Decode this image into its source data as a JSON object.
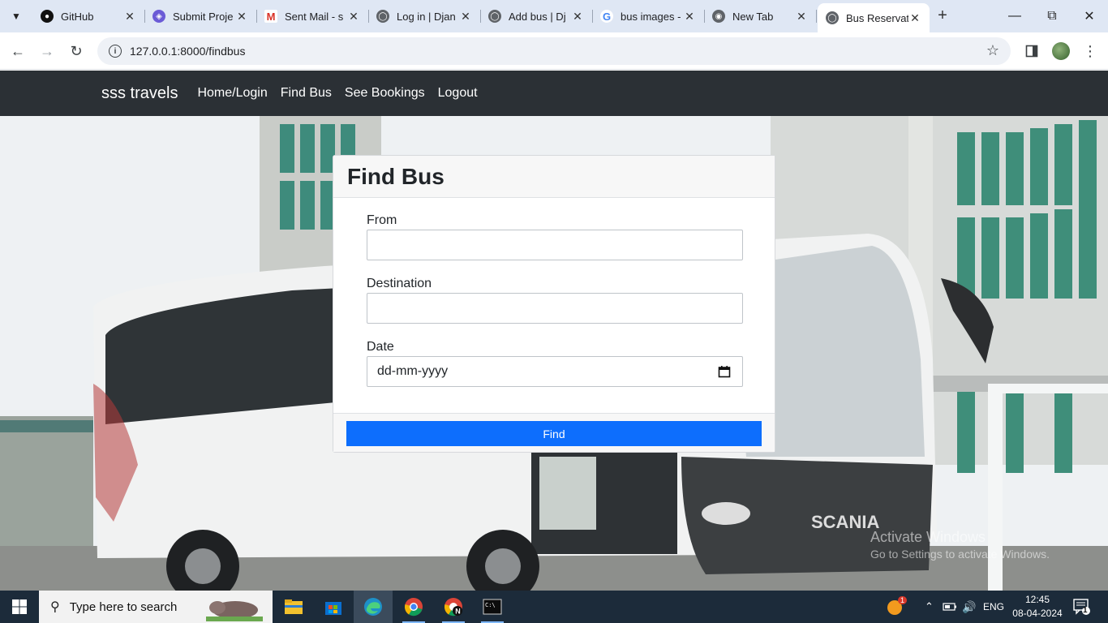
{
  "browser": {
    "tabs": [
      {
        "title": "GitHub",
        "favicon": "github-icon"
      },
      {
        "title": "Submit Proje",
        "favicon": "submit-project-icon"
      },
      {
        "title": "Sent Mail - s",
        "favicon": "gmail-icon"
      },
      {
        "title": "Log in | Djan",
        "favicon": "globe-icon"
      },
      {
        "title": "Add bus | Dj",
        "favicon": "globe-icon"
      },
      {
        "title": "bus images -",
        "favicon": "google-icon"
      },
      {
        "title": "New Tab",
        "favicon": "chrome-icon"
      },
      {
        "title": "Bus Reservat",
        "favicon": "globe-icon",
        "active": true
      }
    ],
    "url": "127.0.0.1:8000/findbus"
  },
  "site": {
    "brand": "sss travels",
    "nav": [
      "Home/Login",
      "Find Bus",
      "See Bookings",
      "Logout"
    ]
  },
  "form": {
    "title": "Find Bus",
    "from_label": "From",
    "from_value": "",
    "destination_label": "Destination",
    "destination_value": "",
    "date_label": "Date",
    "date_placeholder": "dd-mm-yyyy",
    "submit_label": "Find"
  },
  "background": {
    "bus_brand": "SCANIA"
  },
  "watermark": {
    "line1": "Activate Windows",
    "line2": "Go to Settings to activate Windows."
  },
  "taskbar": {
    "search_placeholder": "Type here to search",
    "notification_badge": "1",
    "tray_language": "ENG",
    "time": "12:45",
    "date": "08-04-2024",
    "action_center_count": "1"
  },
  "colors": {
    "navbar": "#2b3035",
    "primary": "#0d6efd",
    "taskbar": "#1c2b3a"
  }
}
